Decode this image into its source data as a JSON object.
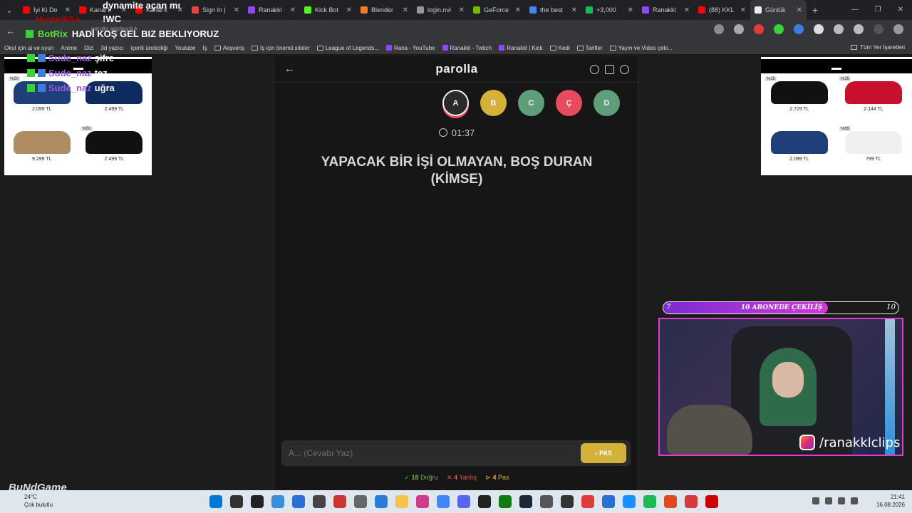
{
  "tabs": [
    {
      "label": "İyi Ki Do",
      "color": "#ff0000"
    },
    {
      "label": "Kanal k",
      "color": "#ff0000"
    },
    {
      "label": "Kanal k",
      "color": "#ff0000"
    },
    {
      "label": "Sign In |",
      "color": "#e8423a"
    },
    {
      "label": "Ranakkl",
      "color": "#9146ff"
    },
    {
      "label": "Kick Bot",
      "color": "#53fc18"
    },
    {
      "label": "Blender",
      "color": "#f5792a"
    },
    {
      "label": "login.nvi",
      "color": "#999999"
    },
    {
      "label": "GeForce",
      "color": "#76b900"
    },
    {
      "label": "the best",
      "color": "#4285f4"
    },
    {
      "label": "+3,000",
      "color": "#1db954"
    },
    {
      "label": "Ranakkl",
      "color": "#9146ff"
    },
    {
      "label": "(88) KKL",
      "color": "#ff0000"
    },
    {
      "label": "Günlük",
      "color": "#eeeeee",
      "active": true
    }
  ],
  "address": {
    "url": "parolla.app/gunluk"
  },
  "bookmarks": [
    {
      "label": "Okul için ai ve oyun",
      "type": "text"
    },
    {
      "label": "Anime",
      "type": "text"
    },
    {
      "label": "Dizi",
      "type": "text"
    },
    {
      "label": "3d yazıcı",
      "type": "text"
    },
    {
      "label": "içerik üreticiliği",
      "type": "text"
    },
    {
      "label": "Youtube",
      "type": "text"
    },
    {
      "label": "İş",
      "type": "text"
    },
    {
      "label": "Alışveriş",
      "type": "folder"
    },
    {
      "label": "İş için önemli siteler",
      "type": "folder"
    },
    {
      "label": "League of Legends...",
      "type": "folder"
    },
    {
      "label": "Rana - YouTube",
      "type": "site"
    },
    {
      "label": "Ranakkl - Twitch",
      "type": "site"
    },
    {
      "label": "Ranakkl | Kick",
      "type": "site"
    },
    {
      "label": "Kedi",
      "type": "folder"
    },
    {
      "label": "Tarifler",
      "type": "folder"
    },
    {
      "label": "Yayın ve Video çeki...",
      "type": "folder"
    }
  ],
  "bookmarks_right": "Tüm Yer İşaretleri",
  "app": {
    "logo": "parolla",
    "letters": [
      {
        "label": "A",
        "color": "#2a2a2a",
        "active": true
      },
      {
        "label": "B",
        "color": "#d4b23a"
      },
      {
        "label": "C",
        "color": "#5e9e7a"
      },
      {
        "label": "Ç",
        "color": "#e84a5f"
      },
      {
        "label": "D",
        "color": "#5e9e7a"
      }
    ],
    "timer": "01:37",
    "question": "YAPACAK BİR İŞİ OLMAYAN, BOŞ DURAN (KİMSE)",
    "answer_placeholder": "A... (Cevabı Yaz)",
    "pass_label": "PAS",
    "stats": {
      "correct_count": "18",
      "correct_label": "Doğru",
      "wrong_count": "4",
      "wrong_label": "Yanlış",
      "pass_count": "4",
      "pass_label": "Pas"
    }
  },
  "ads": {
    "left": [
      {
        "price": "2.099 TL",
        "discount": "%50",
        "color": "#1f3f7a"
      },
      {
        "price": "2.499 TL",
        "discount": "",
        "color": "#0e2a5e"
      },
      {
        "price": "9.299 TL",
        "discount": "",
        "color": "#b08c62"
      },
      {
        "price": "2.499 TL",
        "discount": "%50",
        "color": "#111111"
      }
    ],
    "right": [
      {
        "price": "2.729 TL",
        "discount": "%35",
        "color": "#111111"
      },
      {
        "price": "2.144 TL",
        "discount": "%35",
        "color": "#c8102e"
      },
      {
        "price": "2.099 TL",
        "discount": "",
        "color": "#1f3f7a"
      },
      {
        "price": "799 TL",
        "discount": "%69",
        "color": "#f0f0f0"
      }
    ]
  },
  "overlay": {
    "dynamite": "dynamite açan mı",
    "red_text": "HynterBSo",
    "wc": "!WC",
    "botrix_name": "BotRix",
    "botrix_msg": "HADİ KOŞ GEL BIZ BEKLIYORUZ",
    "user_lines": [
      {
        "name": "Sude_naz",
        "msg": "şifre"
      },
      {
        "name": "Sude_naz",
        "msg": "tez"
      },
      {
        "name": "Sude_naz",
        "msg": "uğra"
      }
    ],
    "sub_goal": {
      "label": "10 ABONEDE ÇEKİLİŞ",
      "current": "7",
      "target": "10",
      "progress": 0.7
    },
    "cam_handle": "/ranakklclips",
    "watermark": "BuNdGame"
  },
  "taskbar": {
    "temp": "24°C",
    "weather": "Çok bulutlu",
    "time": "21:41",
    "date": "16.08.2026",
    "icons": [
      "#0078d4",
      "#333333",
      "#222222",
      "#3b8ed8",
      "#2b6fd6",
      "#444444",
      "#cc3333",
      "#666666",
      "#2b7cd3",
      "#f3c44b",
      "#d13b8a",
      "#4285f4",
      "#5865f2",
      "#222222",
      "#107c10",
      "#1b2838",
      "#555555",
      "#333333",
      "#e23b3b",
      "#2a6fd6",
      "#1a8fff",
      "#1db954",
      "#e04a1f",
      "#d63a3a",
      "#cc0000"
    ]
  }
}
